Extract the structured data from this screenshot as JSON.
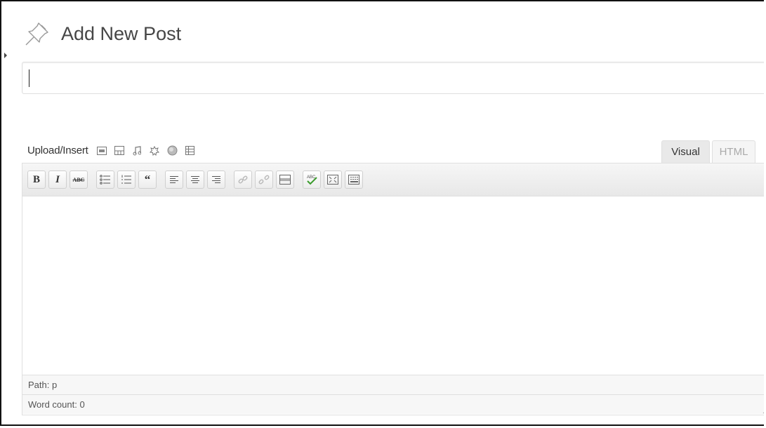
{
  "page": {
    "title": "Add New Post"
  },
  "title_field": {
    "value": "",
    "placeholder": ""
  },
  "media": {
    "label": "Upload/Insert",
    "icons": [
      "image-icon",
      "gallery-icon",
      "audio-icon",
      "video-icon",
      "media-icon",
      "library-icon"
    ]
  },
  "tabs": {
    "visual": "Visual",
    "html": "HTML",
    "active": "visual"
  },
  "toolbar": {
    "buttons": [
      {
        "name": "bold-button",
        "label": "B"
      },
      {
        "name": "italic-button",
        "label": "I"
      },
      {
        "name": "strikethrough-button",
        "label": "ABC"
      },
      {
        "name": "bullet-list-button",
        "icon": "bullet-list-icon"
      },
      {
        "name": "numbered-list-button",
        "icon": "numbered-list-icon"
      },
      {
        "name": "blockquote-button",
        "label": "66"
      },
      {
        "name": "align-left-button",
        "icon": "align-left-icon"
      },
      {
        "name": "align-center-button",
        "icon": "align-center-icon"
      },
      {
        "name": "align-right-button",
        "icon": "align-right-icon"
      },
      {
        "name": "link-button",
        "icon": "link-icon"
      },
      {
        "name": "unlink-button",
        "icon": "unlink-icon"
      },
      {
        "name": "more-tag-button",
        "icon": "more-tag-icon"
      },
      {
        "name": "spellcheck-button",
        "icon": "spellcheck-icon"
      },
      {
        "name": "fullscreen-button",
        "icon": "fullscreen-icon"
      },
      {
        "name": "kitchen-sink-button",
        "icon": "kitchen-sink-icon"
      }
    ]
  },
  "status": {
    "path": "Path: p",
    "word_count": "Word count: 0"
  },
  "colors": {
    "border": "#dfdfdf",
    "toolbar_bg": "#ececec",
    "spellcheck": "#3a9b2c"
  }
}
